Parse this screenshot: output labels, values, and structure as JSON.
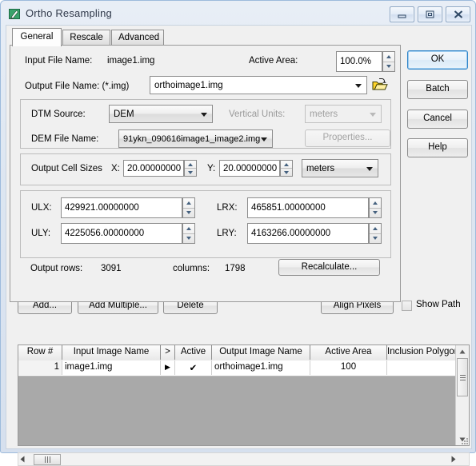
{
  "window": {
    "title": "Ortho Resampling",
    "icon": "ortho-app-icon",
    "buttons": {
      "minimize": "minimize-icon",
      "maximize": "maximize-icon",
      "close": "close-icon"
    }
  },
  "tabs": [
    {
      "label": "General",
      "active": true
    },
    {
      "label": "Rescale",
      "active": false
    },
    {
      "label": "Advanced",
      "active": false
    }
  ],
  "general": {
    "input_file_label": "Input File Name:",
    "input_file_value": "image1.img",
    "active_area_label": "Active Area:",
    "active_area_value": "100.0%",
    "output_file_label": "Output File Name: (*.img)",
    "output_file_value": "orthoimage1.img",
    "browse_icon": "open-folder-icon",
    "dtm_source_label": "DTM Source:",
    "dtm_source_value": "DEM",
    "vertical_units_label": "Vertical Units:",
    "vertical_units_value": "meters",
    "dem_file_label": "DEM File Name:",
    "dem_file_value": "91ykn_090616image1_image2.img",
    "properties_button": "Properties...",
    "cell_sizes_label": "Output Cell Sizes",
    "cell_x_label": "X:",
    "cell_x_value": "20.00000000",
    "cell_y_label": "Y:",
    "cell_y_value": "20.00000000",
    "cell_units_value": "meters",
    "ulx_label": "ULX:",
    "ulx_value": "429921.00000000",
    "lrx_label": "LRX:",
    "lrx_value": "465851.00000000",
    "uly_label": "ULY:",
    "uly_value": "4225056.00000000",
    "lry_label": "LRY:",
    "lry_value": "4163266.00000000",
    "output_rows_label": "Output rows:",
    "output_rows_value": "3091",
    "columns_label": "columns:",
    "columns_value": "1798",
    "recalculate_button": "Recalculate..."
  },
  "dialog_buttons": {
    "ok": "OK",
    "batch": "Batch",
    "cancel": "Cancel",
    "help": "Help"
  },
  "list_toolbar": {
    "add": "Add...",
    "add_multiple": "Add Multiple...",
    "delete": "Delete",
    "align_pixels": "Align Pixels",
    "show_path": "Show Path",
    "show_path_checked": false
  },
  "table": {
    "columns": [
      "Row #",
      "Input Image Name",
      ">",
      "Active",
      "Output Image Name",
      "Active Area",
      "Inclusion Polygon Nar"
    ],
    "rows": [
      {
        "row_num": "1",
        "input_image_name": "image1.img",
        "marker": "▶",
        "active": "✔",
        "output_image_name": "orthoimage1.img",
        "active_area": "100",
        "inclusion_polygon_name": ""
      }
    ]
  },
  "colors": {
    "titlebar_gradient_top": "#e8eef6",
    "client_bg": "#f0f0f0",
    "default_button_border": "#2f84c9",
    "grid_empty_bg": "#a9a9a9",
    "folder_icon": "#ffd42a"
  }
}
